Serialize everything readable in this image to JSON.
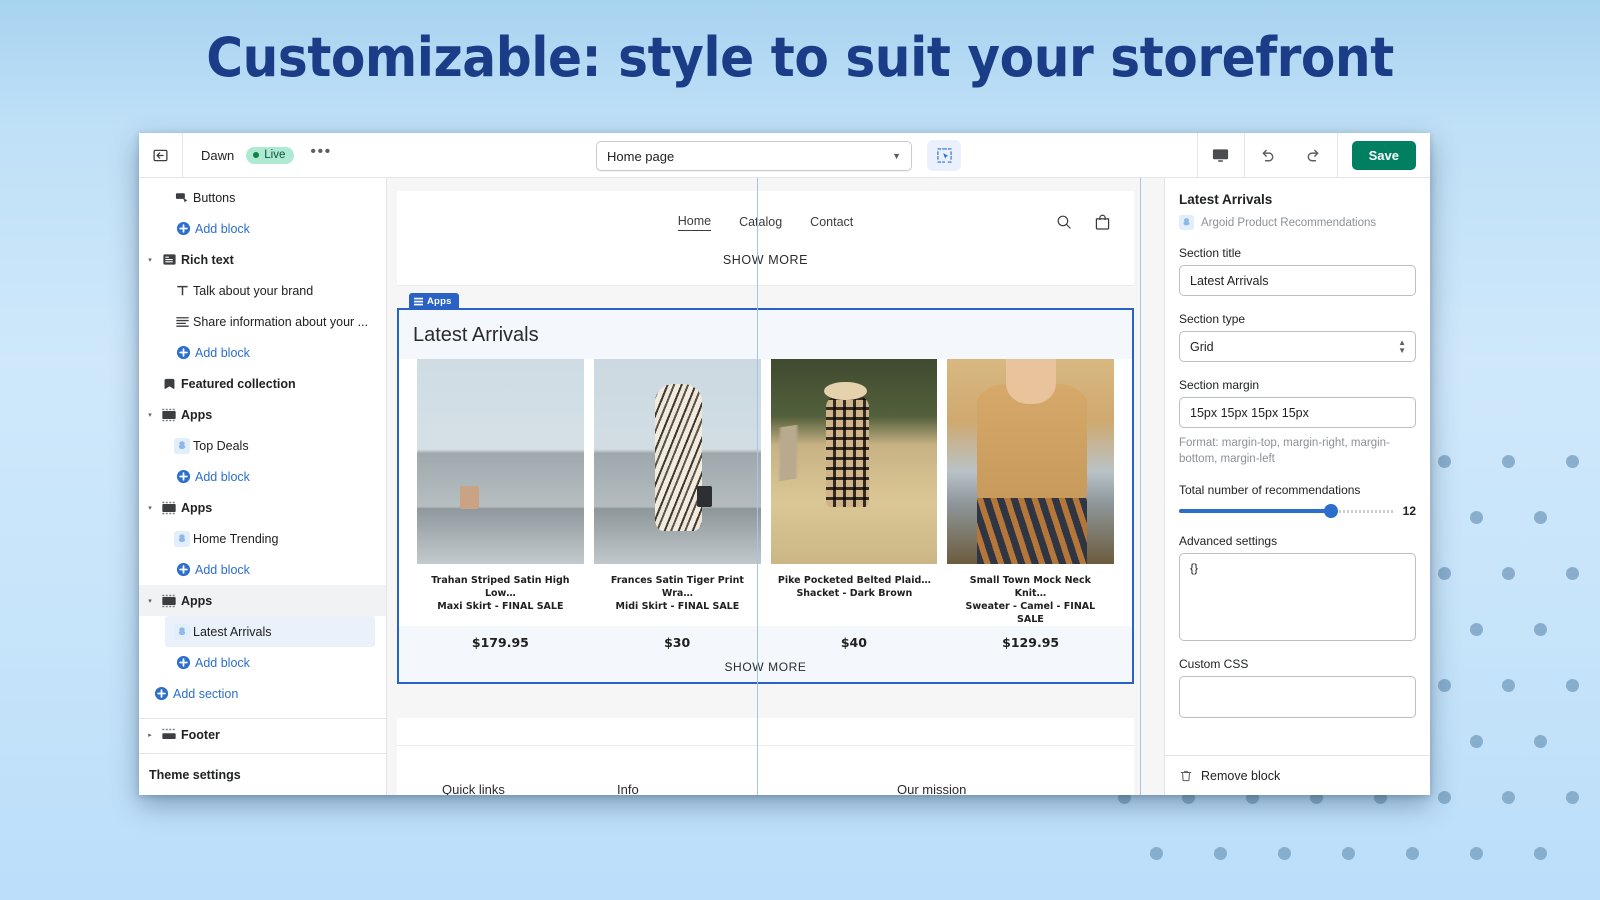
{
  "headline": "Customizable: style to suit your storefront",
  "topbar": {
    "back_icon": "back-arrow-icon",
    "theme_name": "Dawn",
    "status_label": "Live",
    "more_label": "•••",
    "page_selector": {
      "value": "Home page",
      "caret": "▼"
    },
    "inspector_icon": "select-inspector-icon",
    "device_icon": "desktop-icon",
    "undo_icon": "undo-icon",
    "redo_icon": "redo-icon",
    "save_label": "Save",
    "save_color": "#008060"
  },
  "sidebar": {
    "items": [
      {
        "label": "Buttons",
        "kind": "block",
        "icon": "buttons-icon"
      },
      {
        "label": "Add block",
        "kind": "addblock",
        "icon": "plus-circle-icon"
      },
      {
        "label": "Rich text",
        "kind": "section",
        "icon": "rich-text-icon",
        "twisty": "▾"
      },
      {
        "label": "Talk about your brand",
        "kind": "block",
        "icon": "text-t-icon"
      },
      {
        "label": "Share information about your ...",
        "kind": "block",
        "icon": "paragraph-icon"
      },
      {
        "label": "Add block",
        "kind": "addblock",
        "icon": "plus-circle-icon"
      },
      {
        "label": "Featured collection",
        "kind": "section",
        "icon": "collection-icon",
        "twisty": ""
      },
      {
        "label": "Apps",
        "kind": "section",
        "icon": "apps-icon",
        "twisty": "▾"
      },
      {
        "label": "Top Deals",
        "kind": "block",
        "icon": "argoid-icon"
      },
      {
        "label": "Add block",
        "kind": "addblock",
        "icon": "plus-circle-icon"
      },
      {
        "label": "Apps",
        "kind": "section",
        "icon": "apps-icon",
        "twisty": "▾"
      },
      {
        "label": "Home Trending",
        "kind": "block",
        "icon": "argoid-icon"
      },
      {
        "label": "Add block",
        "kind": "addblock",
        "icon": "plus-circle-icon"
      },
      {
        "label": "Apps",
        "kind": "section-selected",
        "icon": "apps-icon",
        "twisty": "▾"
      },
      {
        "label": "Latest Arrivals",
        "kind": "block-selected",
        "icon": "argoid-icon"
      },
      {
        "label": "Add block",
        "kind": "addblock",
        "icon": "plus-circle-icon"
      },
      {
        "label": "Add section",
        "kind": "addsection",
        "icon": "plus-circle-icon"
      },
      {
        "label": "Footer",
        "kind": "section",
        "icon": "footer-icon",
        "twisty": "▸"
      }
    ],
    "theme_settings_label": "Theme settings"
  },
  "preview": {
    "nav": [
      {
        "label": "Home",
        "active": true
      },
      {
        "label": "Catalog",
        "active": false
      },
      {
        "label": "Contact",
        "active": false
      }
    ],
    "search_icon": "search-icon",
    "cart_icon": "shopping-bag-icon",
    "show_more_top": "SHOW MORE",
    "apps_badge": "Apps",
    "section_title": "Latest Arrivals",
    "products": [
      {
        "name": "Trahan Striped Satin High Low…\nMaxi Skirt - FINAL SALE",
        "price": "$179.95"
      },
      {
        "name": "Frances Satin Tiger Print Wra…\nMidi Skirt - FINAL SALE",
        "price": "$30"
      },
      {
        "name": "Pike Pocketed Belted Plaid…\nShacket - Dark Brown",
        "price": "$40"
      },
      {
        "name": "Small Town Mock Neck Knit…\nSweater - Camel - FINAL SALE",
        "price": "$129.95"
      }
    ],
    "show_more_bottom": "SHOW MORE",
    "footer_columns": [
      "Quick links",
      "Info",
      "Our mission"
    ]
  },
  "settings": {
    "title": "Latest Arrivals",
    "app_name": "Argoid Product Recommendations",
    "app_icon": "argoid-icon",
    "section_title_label": "Section title",
    "section_title_value": "Latest Arrivals",
    "section_type_label": "Section type",
    "section_type_value": "Grid",
    "section_margin_label": "Section margin",
    "section_margin_value": "15px 15px 15px 15px",
    "section_margin_help": "Format: margin-top, margin-right, margin-bottom, margin-left",
    "recommendations_label": "Total number of recommendations",
    "recommendations_value": "12",
    "advanced_label": "Advanced settings",
    "advanced_value": "{}",
    "custom_css_label": "Custom CSS",
    "custom_css_value": "",
    "remove_label": "Remove block",
    "remove_icon": "trash-icon"
  }
}
